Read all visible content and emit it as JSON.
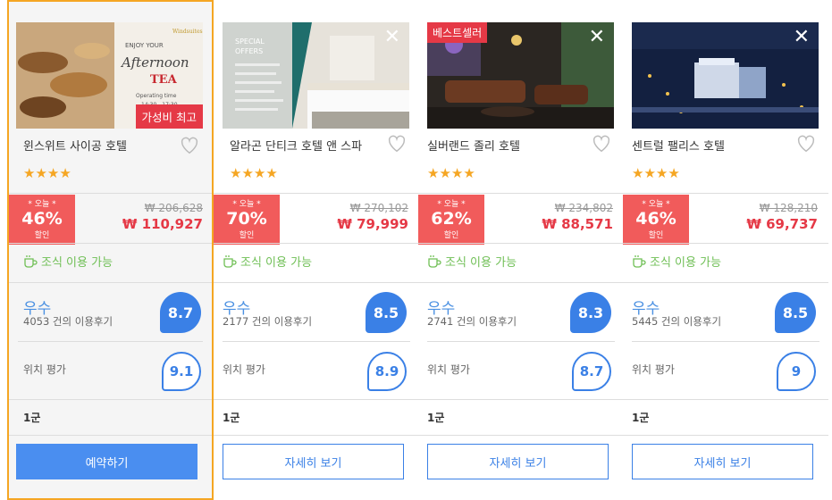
{
  "colors": {
    "accent": "#3a80e6",
    "discount": "#f15b5b",
    "star": "#f5a623",
    "breakfast": "#6fbf55",
    "selected_border": "#f5a623"
  },
  "cards": [
    {
      "name": "윈스위트 사이공 호텔",
      "badge": "가성비 최고",
      "stars": "★★★★",
      "disc_label": "* 오늘 *",
      "disc_pct": "46%",
      "disc_unit": "할인",
      "old_price": "₩ 206,628",
      "new_price": "₩ 110,927",
      "breakfast": "조식 이용 가능",
      "grade": "우수",
      "reviews": "4053 건의 이용후기",
      "score": "8.7",
      "loc_label": "위치 평가",
      "loc_score": "9.1",
      "district": "1군",
      "button": "예약하기",
      "photo_text": [
        "Windsuites",
        "ENJOY YOUR",
        "Afternoon",
        "TEA",
        "Operating time",
        "14:30 - 17:30"
      ]
    },
    {
      "name": "알라곤 단티크 호텔 앤 스파",
      "stars": "★★★★",
      "disc_label": "* 오늘 *",
      "disc_pct": "70%",
      "disc_unit": "할인",
      "old_price": "₩ 270,102",
      "new_price": "₩ 79,999",
      "breakfast": "조식 이용 가능",
      "grade": "우수",
      "reviews": "2177 건의 이용후기",
      "score": "8.5",
      "loc_label": "위치 평가",
      "loc_score": "8.9",
      "district": "1군",
      "button": "자세히 보기",
      "close": "✕",
      "photo_text": [
        "SPECIAL",
        "OFFERS"
      ]
    },
    {
      "name": "실버랜드 졸리 호텔",
      "badge": "베스트셀러",
      "stars": "★★★★",
      "disc_label": "* 오늘 *",
      "disc_pct": "62%",
      "disc_unit": "할인",
      "old_price": "₩ 234,802",
      "new_price": "₩ 88,571",
      "breakfast": "조식 이용 가능",
      "grade": "우수",
      "reviews": "2741 건의 이용후기",
      "score": "8.3",
      "loc_label": "위치 평가",
      "loc_score": "8.7",
      "district": "1군",
      "button": "자세히 보기",
      "close": "✕"
    },
    {
      "name": "센트럴 팰리스 호텔",
      "stars": "★★★★",
      "disc_label": "* 오늘 *",
      "disc_pct": "46%",
      "disc_unit": "할인",
      "old_price": "₩ 128,210",
      "new_price": "₩ 69,737",
      "breakfast": "조식 이용 가능",
      "grade": "우수",
      "reviews": "5445 건의 이용후기",
      "score": "8.5",
      "loc_label": "위치 평가",
      "loc_score": "9",
      "district": "1군",
      "button": "자세히 보기",
      "close": "✕"
    }
  ]
}
